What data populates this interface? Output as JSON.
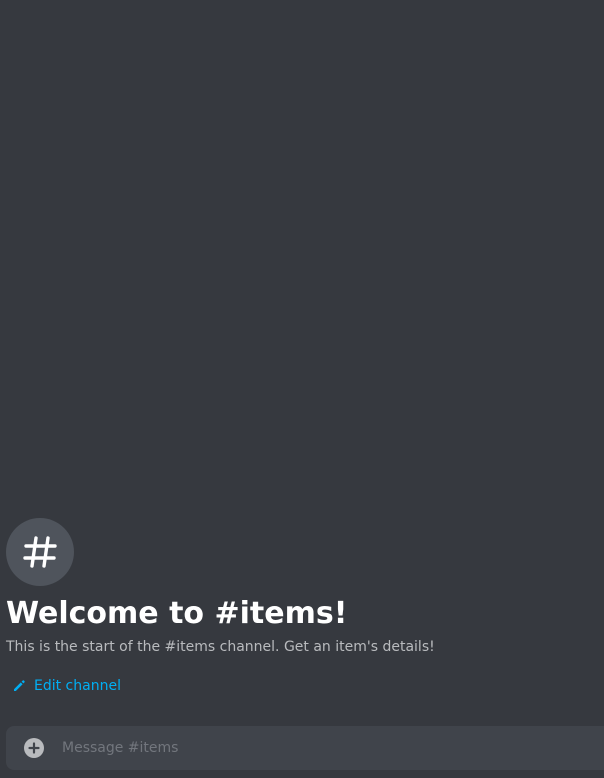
{
  "welcome": {
    "icon": "hash-icon",
    "title": "Welcome to #items!",
    "description": "This is the start of the #items channel. Get an item's details!"
  },
  "actions": {
    "edit_channel_icon": "pencil-icon",
    "edit_channel_label": "Edit channel"
  },
  "composer": {
    "attach_icon": "add-circle-icon",
    "placeholder": "Message #items",
    "value": ""
  },
  "colors": {
    "background": "#36393f",
    "icon_circle": "#4f545c",
    "title": "#ffffff",
    "description": "#b9bbbe",
    "link": "#00aff4",
    "composer_background": "#40444b",
    "placeholder": "#72767d"
  }
}
